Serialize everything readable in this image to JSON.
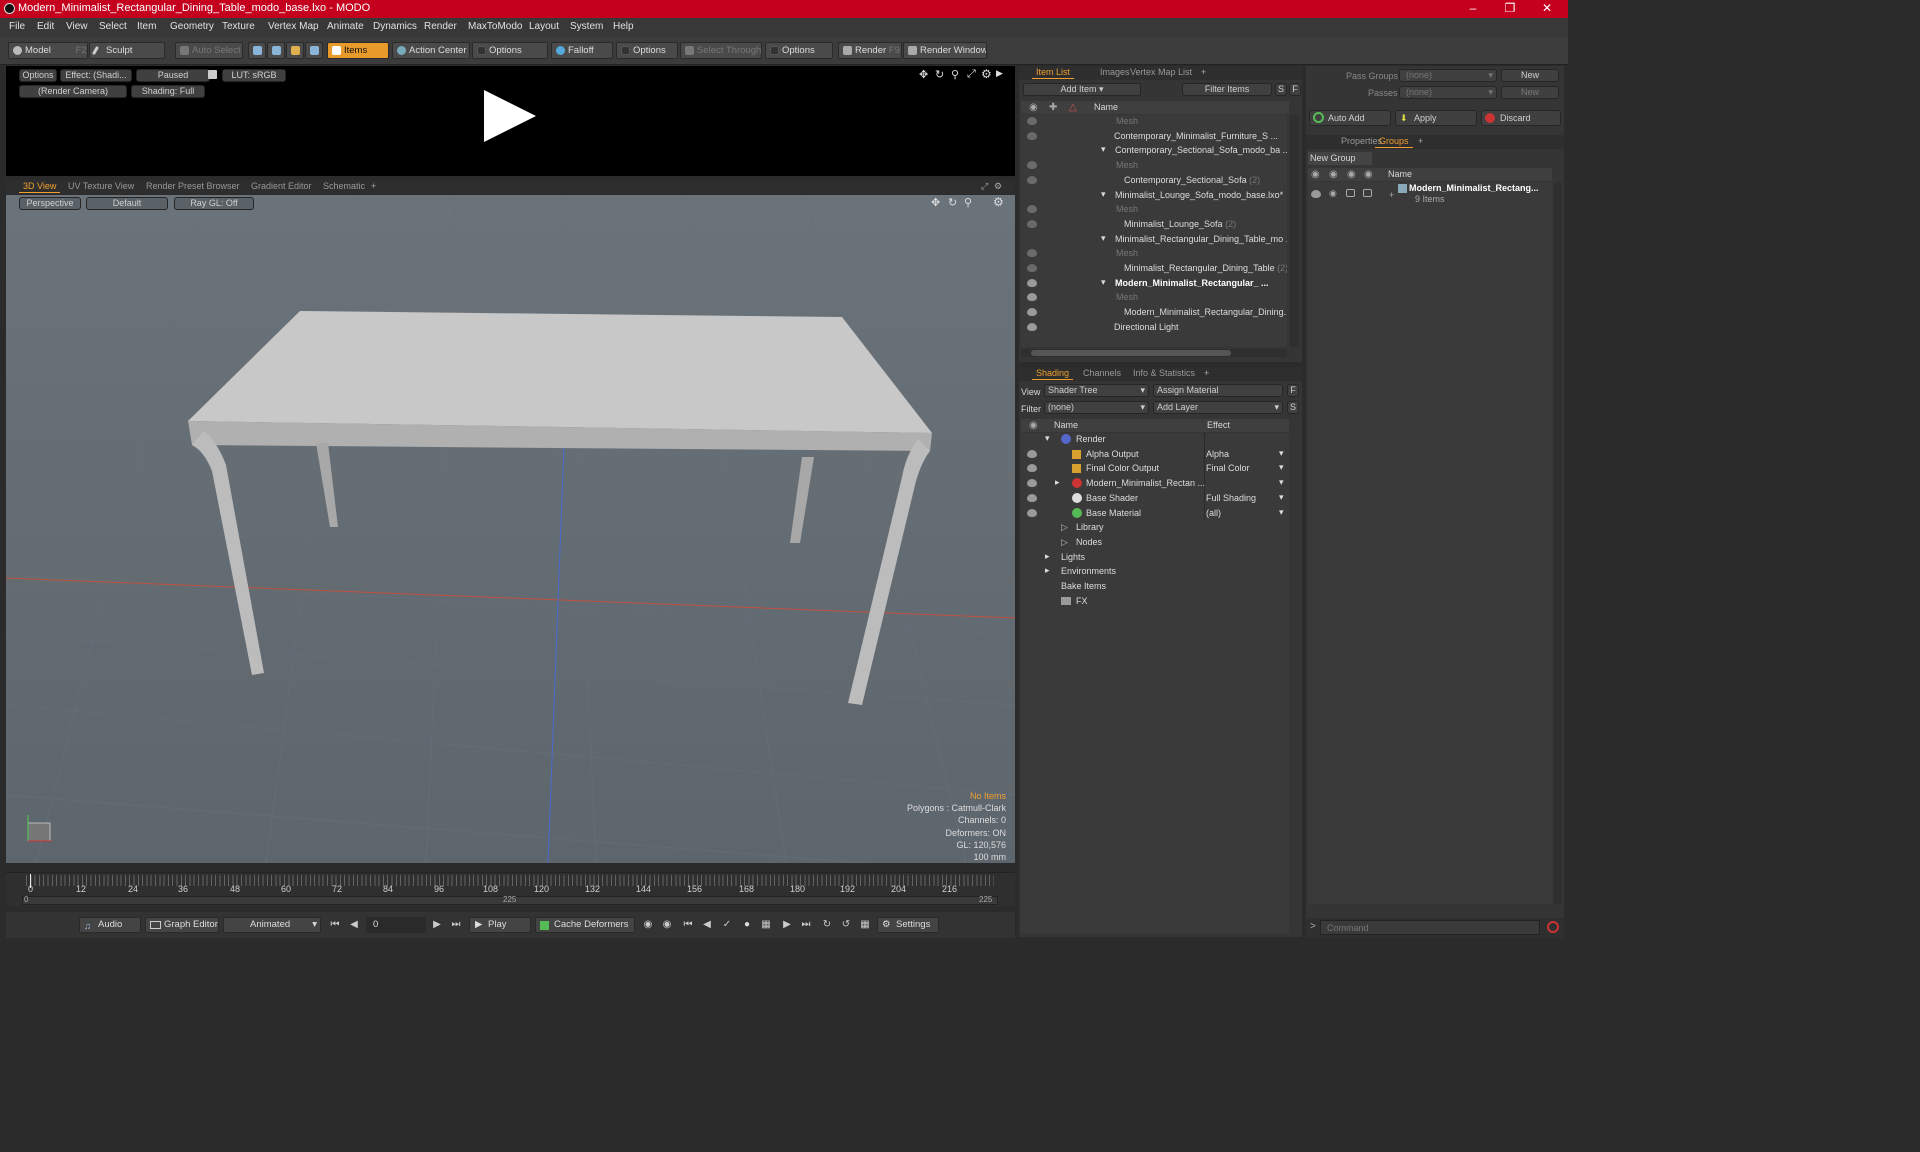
{
  "title_bar": {
    "title": "Modern_Minimalist_Rectangular_Dining_Table_modo_base.lxo - MODO"
  },
  "menu": [
    "File",
    "Edit",
    "View",
    "Select",
    "Item",
    "Geometry",
    "Texture",
    "Vertex Map",
    "Animate",
    "Dynamics",
    "Render",
    "MaxToModo",
    "Layout",
    "System",
    "Help"
  ],
  "toolbar": {
    "model": "Model",
    "model_key": "F2",
    "sculpt": "Sculpt",
    "auto_select": "Auto Select",
    "items": "Items",
    "action_center": "Action Center",
    "options1": "Options",
    "falloff": "Falloff",
    "options2": "Options",
    "select_through": "Select Through",
    "options3": "Options",
    "render": "Render",
    "render_key": "F9",
    "render_window": "Render Window"
  },
  "preview": {
    "options": "Options",
    "effect": "Effect: (Shadi...",
    "paused": "Paused",
    "lut": "LUT: sRGB",
    "camera": "(Render Camera)",
    "shading": "Shading: Full"
  },
  "view_tabs": [
    "3D View",
    "UV Texture View",
    "Render Preset Browser",
    "Gradient Editor",
    "Schematic"
  ],
  "viewport": {
    "perspective": "Perspective",
    "default": "Default",
    "raygl": "Ray GL: Off",
    "status": {
      "no_items": "No Items",
      "polygons": "Polygons : Catmull-Clark",
      "channels": "Channels: 0",
      "deformers": "Deformers: ON",
      "gl": "GL: 120,576",
      "unit": "100 mm"
    }
  },
  "timeline": {
    "ticks": [
      "0",
      "12",
      "24",
      "36",
      "48",
      "60",
      "72",
      "84",
      "96",
      "108",
      "120",
      "132",
      "144",
      "156",
      "168",
      "180",
      "192",
      "204",
      "216"
    ],
    "sub_left": "0",
    "sub_mid": "225",
    "sub_right": "225"
  },
  "bottom": {
    "audio": "Audio",
    "graph_editor": "Graph Editor",
    "animated": "Animated",
    "frame": "0",
    "play": "Play",
    "cache": "Cache Deformers",
    "settings": "Settings"
  },
  "item_list": {
    "tabs": [
      "Item List",
      "Images",
      "Vertex Map List"
    ],
    "add_item": "Add Item",
    "filter_items": "Filter Items",
    "s": "S",
    "f": "F",
    "col_name": "Name",
    "rows": [
      {
        "label": "Mesh",
        "count": ""
      },
      {
        "label": "Contemporary_Minimalist_Furniture_S ...",
        "count": ""
      },
      {
        "label": "Contemporary_Sectional_Sofa_modo_ba ...",
        "count": ""
      },
      {
        "label": "Mesh",
        "count": ""
      },
      {
        "label": "Contemporary_Sectional_Sofa",
        "count": "(2)"
      },
      {
        "label": "Minimalist_Lounge_Sofa_modo_base.lxo*",
        "count": ""
      },
      {
        "label": "Mesh",
        "count": ""
      },
      {
        "label": "Minimalist_Lounge_Sofa",
        "count": "(2)"
      },
      {
        "label": "Minimalist_Rectangular_Dining_Table_mo ...",
        "count": ""
      },
      {
        "label": "Mesh",
        "count": ""
      },
      {
        "label": "Minimalist_Rectangular_Dining_Table",
        "count": "(2)"
      },
      {
        "label": "Modern_Minimalist_Rectangular_ ...",
        "count": ""
      },
      {
        "label": "Mesh",
        "count": ""
      },
      {
        "label": "Modern_Minimalist_Rectangular_Dining...",
        "count": ""
      },
      {
        "label": "Directional Light",
        "count": ""
      }
    ]
  },
  "shading": {
    "tabs": [
      "Shading",
      "Channels",
      "Info & Statistics"
    ],
    "view_label": "View",
    "view_value": "Shader Tree",
    "assign": "Assign Material",
    "filter_label": "Filter",
    "filter_value": "(none)",
    "add_layer": "Add Layer",
    "f": "F",
    "s": "S",
    "col_name": "Name",
    "col_effect": "Effect",
    "rows": [
      {
        "label": "Render",
        "effect": ""
      },
      {
        "label": "Alpha Output",
        "effect": "Alpha"
      },
      {
        "label": "Final Color Output",
        "effect": "Final Color"
      },
      {
        "label": "Modern_Minimalist_Rectan ...",
        "effect": ""
      },
      {
        "label": "Base Shader",
        "effect": "Full Shading"
      },
      {
        "label": "Base Material",
        "effect": "(all)"
      },
      {
        "label": "Library",
        "effect": ""
      },
      {
        "label": "Nodes",
        "effect": ""
      },
      {
        "label": "Lights",
        "effect": ""
      },
      {
        "label": "Environments",
        "effect": ""
      },
      {
        "label": "Bake Items",
        "effect": ""
      },
      {
        "label": "FX",
        "effect": ""
      }
    ]
  },
  "groups": {
    "pass_groups": "Pass Groups",
    "passes": "Passes",
    "none1": "(none)",
    "none2": "(none)",
    "new1": "New",
    "new2": "New",
    "auto_add": "Auto Add",
    "apply": "Apply",
    "discard": "Discard",
    "tabs": [
      "Properties",
      "Groups"
    ],
    "new_group": "New Group",
    "col_name": "Name",
    "group_name": "Modern_Minimalist_Rectang...",
    "group_items": "9 Items"
  },
  "command": {
    "placeholder": "Command"
  },
  "colors": {
    "title": "#c4001e",
    "accent": "#f0a030"
  }
}
